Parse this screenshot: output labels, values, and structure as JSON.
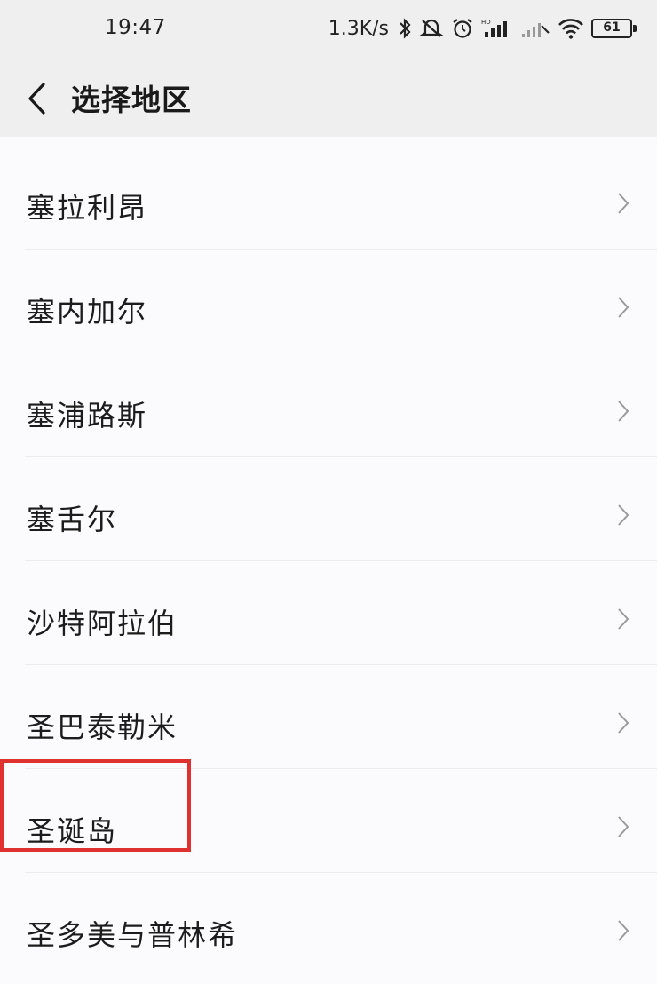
{
  "status_bar": {
    "time": "19:47",
    "net_speed": "1.3K/s",
    "icons": [
      "bluetooth-icon",
      "mute-icon",
      "alarm-icon",
      "hd-signal-icon",
      "signal-icon",
      "wifi-icon"
    ],
    "battery": "61"
  },
  "header": {
    "title": "选择地区",
    "back_icon": "chevron-left-icon"
  },
  "regions": [
    {
      "label": "塞拉利昂"
    },
    {
      "label": "塞内加尔"
    },
    {
      "label": "塞浦路斯"
    },
    {
      "label": "塞舌尔"
    },
    {
      "label": "沙特阿拉伯"
    },
    {
      "label": "圣巴泰勒米"
    },
    {
      "label": "圣诞岛"
    },
    {
      "label": "圣多美与普林希"
    }
  ],
  "highlight": {
    "target": "圣诞岛",
    "color": "#e03131"
  },
  "colors": {
    "background": "#fbfbfd",
    "header": "#efeff0",
    "divider": "#ececef",
    "chevron": "#9a9a9a"
  }
}
